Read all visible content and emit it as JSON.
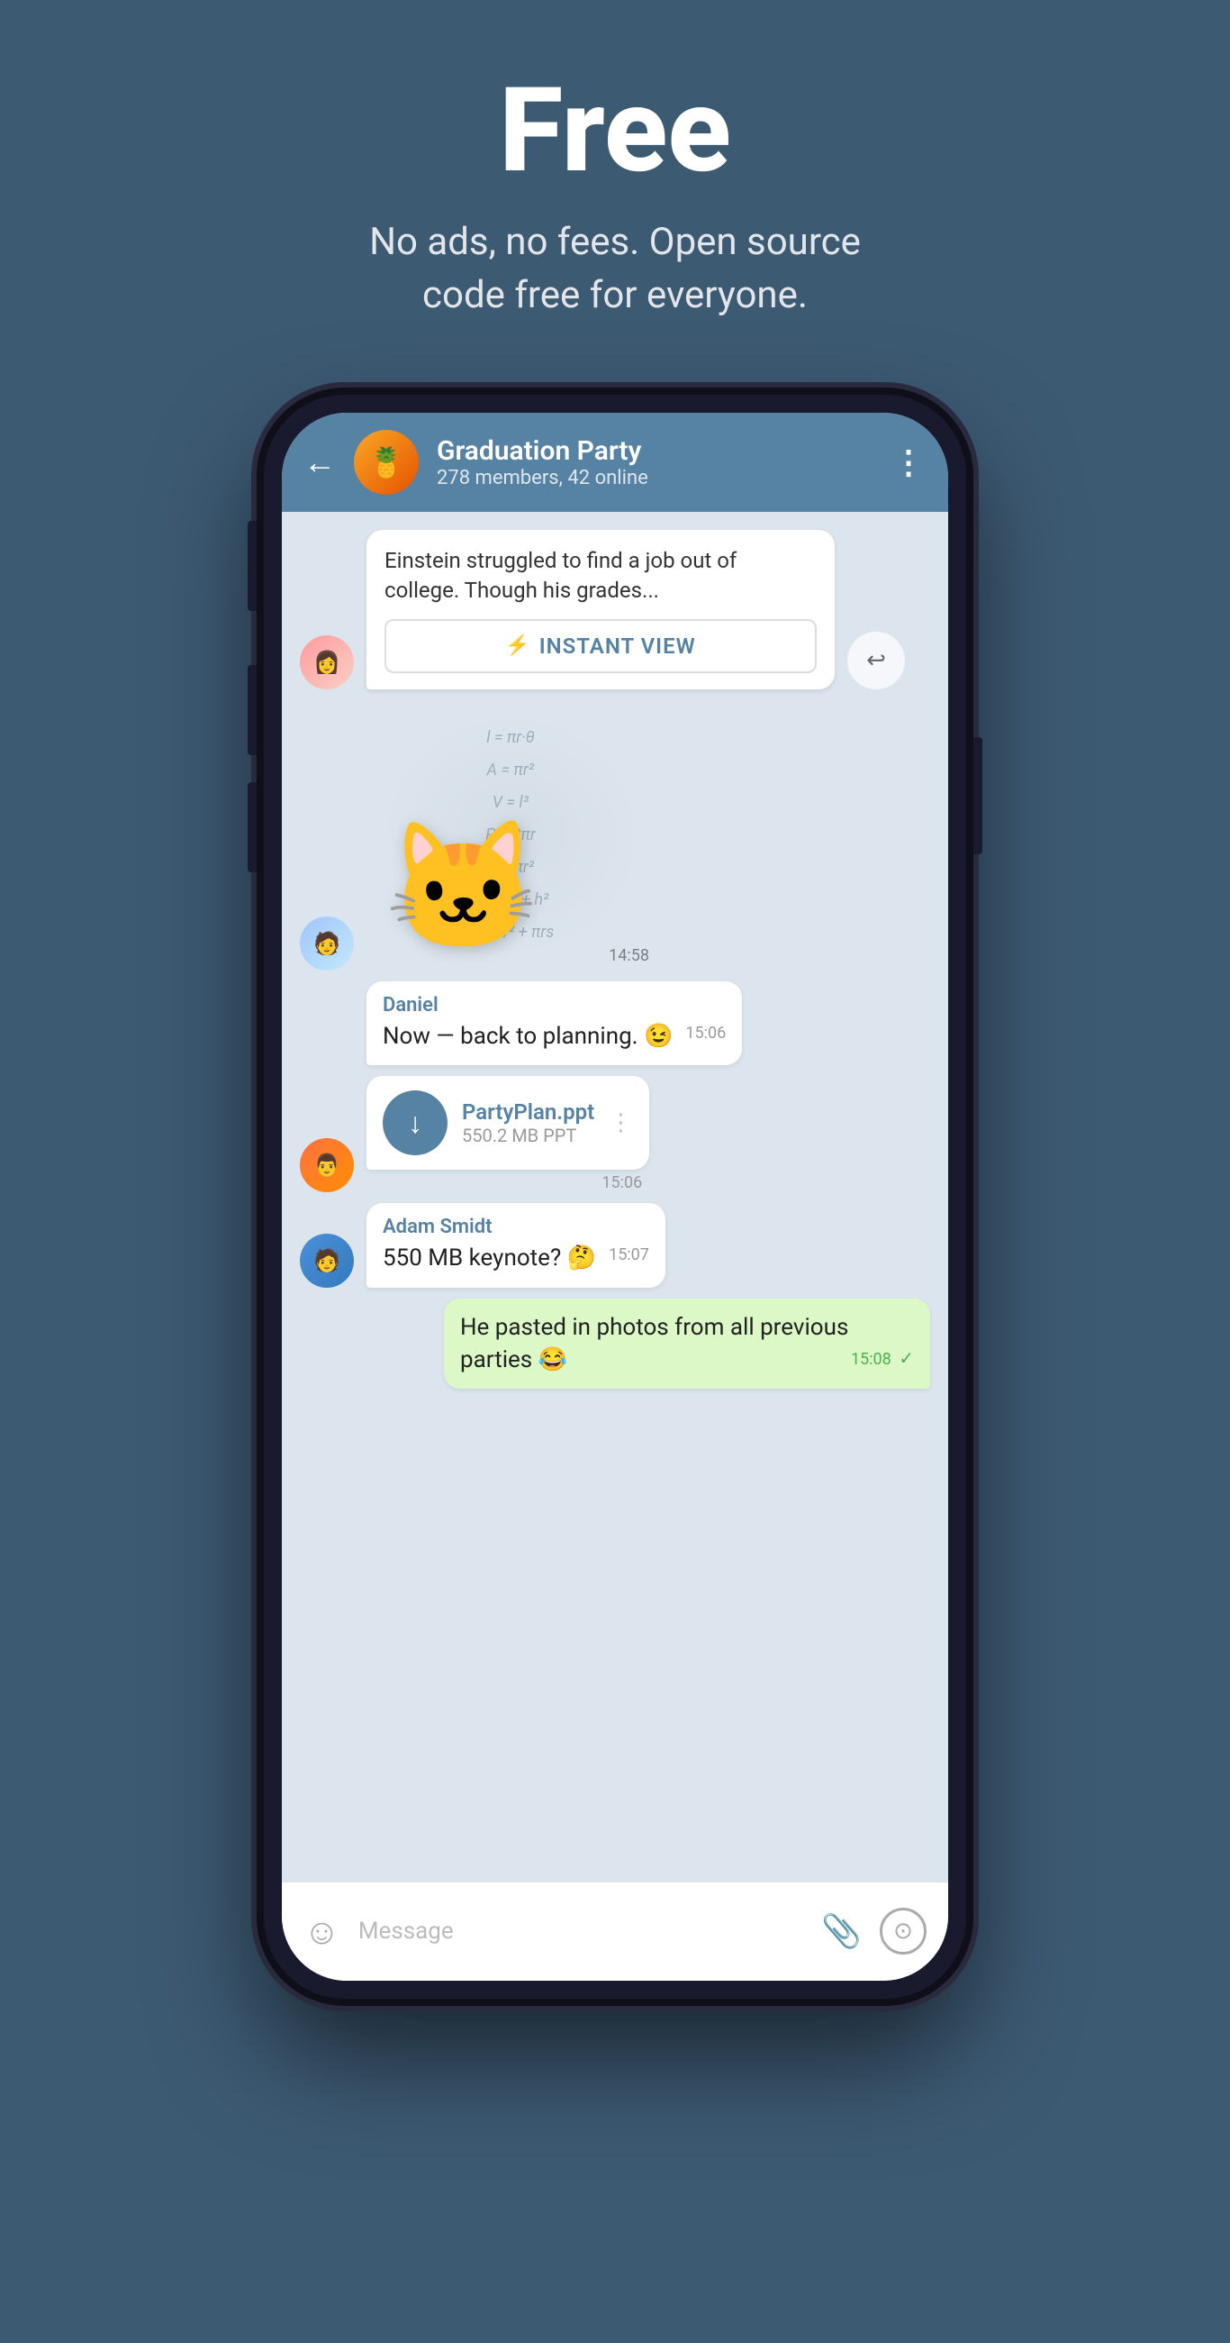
{
  "hero": {
    "title": "Free",
    "subtitle": "No ads, no fees. Open source\ncode free for everyone."
  },
  "chat": {
    "header": {
      "group_name": "Graduation Party",
      "members_info": "278 members, 42 online",
      "back_label": "←",
      "menu_label": "⋮"
    },
    "messages": [
      {
        "type": "link_preview",
        "avatar": "female",
        "preview_text": "Einstein struggled to find a job out of college. Though his grades...",
        "instant_view_label": "INSTANT VIEW"
      },
      {
        "type": "sticker",
        "avatar": "male1",
        "time": "14:58"
      },
      {
        "type": "text",
        "sender": "Daniel",
        "text": "Now — back to planning. 😉",
        "time": "15:06"
      },
      {
        "type": "file",
        "avatar": "male2",
        "file_name": "PartyPlan.ppt",
        "file_size": "550.2 MB PPT",
        "time": "15:06"
      },
      {
        "type": "text",
        "sender": "Adam Smidt",
        "avatar": "male3",
        "text": "550 MB keynote? 🤔",
        "time": "15:07"
      },
      {
        "type": "own",
        "text": "He pasted in photos from all previous parties 😂",
        "time": "15:08"
      }
    ],
    "input": {
      "placeholder": "Message"
    }
  }
}
